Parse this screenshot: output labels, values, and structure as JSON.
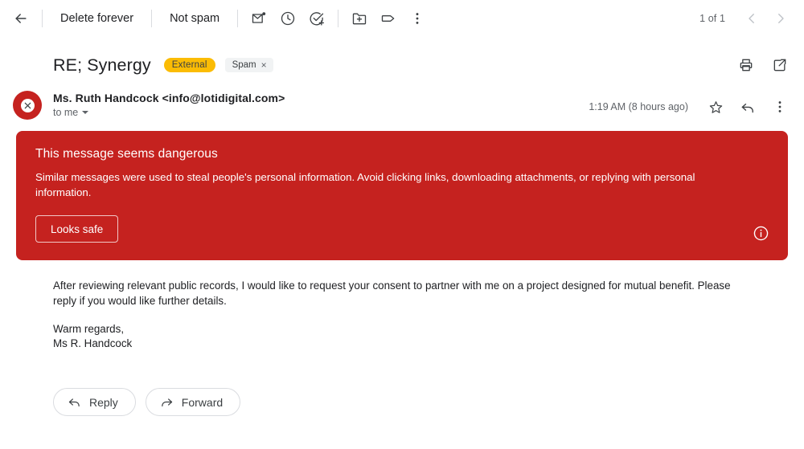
{
  "toolbar": {
    "back_icon": "arrow-back-icon",
    "delete_forever_label": "Delete forever",
    "not_spam_label": "Not spam",
    "icons": [
      {
        "name": "mark-unread-icon"
      },
      {
        "name": "snooze-clock-icon"
      },
      {
        "name": "add-to-tasks-icon"
      },
      {
        "name": "move-to-folder-icon"
      },
      {
        "name": "label-tag-icon"
      },
      {
        "name": "more-options-icon"
      }
    ],
    "pagination": "1 of 1",
    "prev_icon": "chevron-left-icon",
    "next_icon": "chevron-right-icon"
  },
  "subject": {
    "title": "RE; Synergy",
    "external_badge": "External",
    "spam_chip": "Spam",
    "spam_chip_close": "×",
    "print_icon": "print-icon",
    "open_new_window_icon": "open-in-new-icon"
  },
  "sender": {
    "name_line": "Ms. Ruth Handcock <info@lotidigital.com>",
    "to_line": "to me",
    "timestamp": "1:19 AM (8 hours ago)",
    "star_icon": "star-icon",
    "reply_icon": "reply-arrow-icon",
    "more_icon": "more-options-icon",
    "avatar_mark": "✕"
  },
  "banner": {
    "title": "This message seems dangerous",
    "body": "Similar messages were used to steal people's personal information. Avoid clicking links, downloading attachments, or replying with personal information.",
    "button_label": "Looks safe",
    "info_icon": "info-circle-icon",
    "bg_color": "#c5221f"
  },
  "message": {
    "paragraph": "After reviewing relevant public records, I would like to request your consent to partner with me on a project designed for mutual benefit. Please reply if you would like further details.",
    "signoff": "Warm regards,",
    "signature": "Ms R. Handcock"
  },
  "actions": {
    "reply_label": "Reply",
    "forward_label": "Forward",
    "reply_icon": "reply-arrow-icon",
    "forward_icon": "forward-arrow-icon"
  },
  "colors": {
    "danger": "#c5221f",
    "external_badge": "#fbbc04",
    "chip_bg": "#f1f3f4",
    "text_primary": "#202124",
    "text_secondary": "#5f6368"
  }
}
